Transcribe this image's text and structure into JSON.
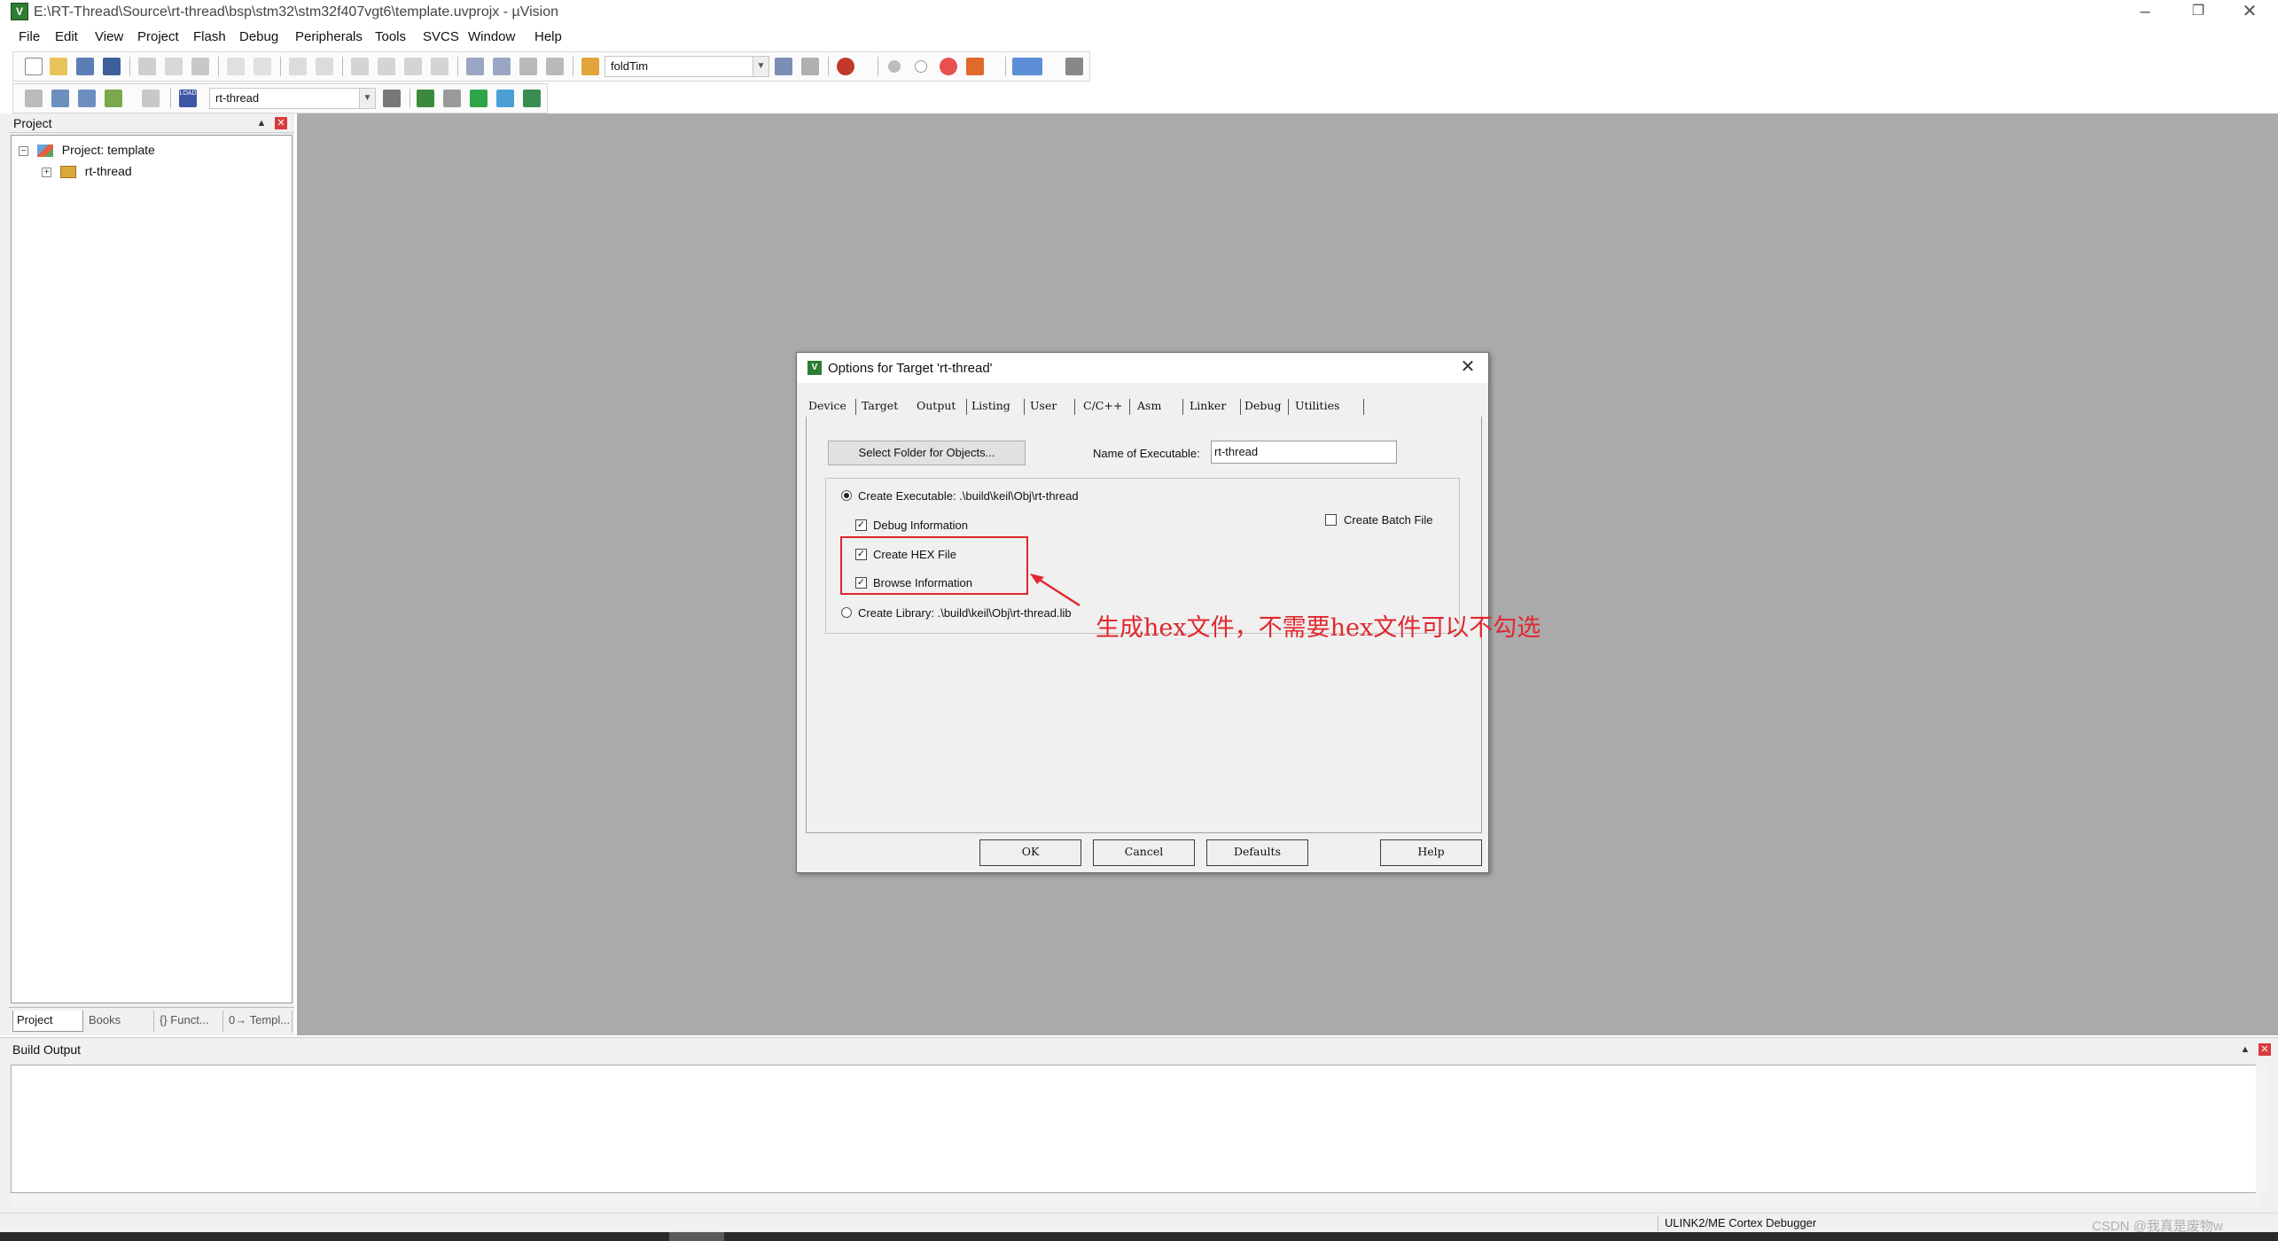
{
  "window": {
    "title": "E:\\RT-Thread\\Source\\rt-thread\\bsp\\stm32\\stm32f407vgt6\\template.uvprojx - µVision"
  },
  "menu": [
    "File",
    "Edit",
    "View",
    "Project",
    "Flash",
    "Debug",
    "Peripherals",
    "Tools",
    "SVCS",
    "Window",
    "Help"
  ],
  "toolbar": {
    "find_combo": "foldTim",
    "target_combo": "rt-thread",
    "load_label": "LOAD"
  },
  "project_panel": {
    "title": "Project",
    "root": "Project: template",
    "child": "rt-thread",
    "tabs": [
      "Project",
      "Books",
      "{} Funct...",
      "0→ Templ..."
    ]
  },
  "build_output": {
    "title": "Build Output"
  },
  "status": {
    "debugger": "ULINK2/ME Cortex Debugger",
    "watermark": "CSDN @我真是废物w"
  },
  "dialog": {
    "title": "Options for Target 'rt-thread'",
    "tabs": [
      "Device",
      "Target",
      "Output",
      "Listing",
      "User",
      "C/C++",
      "Asm",
      "Linker",
      "Debug",
      "Utilities"
    ],
    "active_tab": "Output",
    "select_folder_button": "Select Folder for Objects...",
    "exe_label": "Name of Executable:",
    "exe_value": "rt-thread",
    "create_executable": {
      "label": "Create Executable:  .\\build\\keil\\Obj\\rt-thread",
      "selected": true
    },
    "debug_information": {
      "label": "Debug Information",
      "checked": true
    },
    "create_hex": {
      "label": "Create HEX File",
      "checked": true
    },
    "browse_information": {
      "label": "Browse Information",
      "checked": true
    },
    "create_batch": {
      "label": "Create Batch File",
      "checked": false
    },
    "create_library": {
      "label": "Create Library:  .\\build\\keil\\Obj\\rt-thread.lib",
      "selected": false
    },
    "buttons": {
      "ok": "OK",
      "cancel": "Cancel",
      "defaults": "Defaults",
      "help": "Help"
    }
  },
  "annotation": {
    "text": "生成hex文件，不需要hex文件可以不勾选",
    "color": "#e0282e"
  }
}
